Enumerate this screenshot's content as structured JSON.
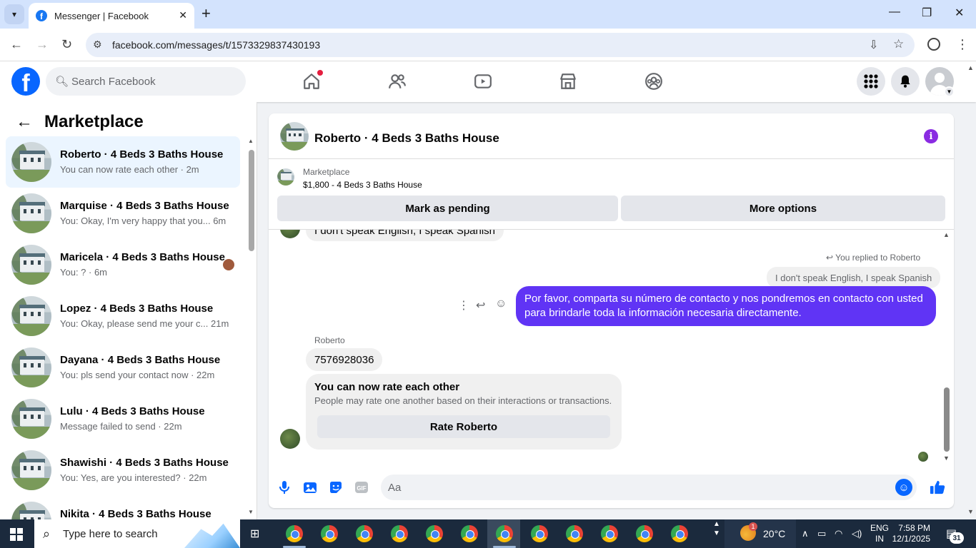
{
  "browser": {
    "tab_title": "Messenger | Facebook",
    "url": "facebook.com/messages/t/1573329837430193"
  },
  "fb": {
    "search_placeholder": "Search Facebook"
  },
  "sidebar": {
    "title": "Marketplace",
    "conversations": [
      {
        "name": "Roberto · 4 Beds 3 Baths House",
        "snippet": "You can now rate each other · 2m",
        "active": true
      },
      {
        "name": "Marquise · 4 Beds 3 Baths House",
        "snippet": "You: Okay, I'm very happy that you...  6m"
      },
      {
        "name": "Maricela · 4 Beds 3 Baths House",
        "snippet": "You: ? · 6m"
      },
      {
        "name": "Lopez · 4 Beds 3 Baths House",
        "snippet": "You: Okay, please send me your c...  21m"
      },
      {
        "name": "Dayana · 4 Beds 3 Baths House",
        "snippet": "You: pls send your contact now · 22m"
      },
      {
        "name": "Lulu · 4 Beds 3 Baths House",
        "snippet": "Message failed to send · 22m"
      },
      {
        "name": "Shawishi · 4 Beds 3 Baths House",
        "snippet": "You: Yes, are you interested? · 22m"
      },
      {
        "name": "Nikita · 4 Beds 3 Baths House",
        "snippet": ""
      }
    ]
  },
  "chat": {
    "header_name": "Roberto · 4 Beds 3 Baths House",
    "listing_category": "Marketplace",
    "listing_price": "$1,800 - 4 Beds 3 Baths House",
    "mark_pending_label": "Mark as pending",
    "more_options_label": "More options",
    "cut_message": "I don't speak English, I speak Spanish",
    "replied_tag": "You replied to Roberto",
    "reply_quote": "I don't speak English, I speak Spanish",
    "outgoing_message": "Por favor, comparta su número de contacto y nos pondremos en contacto con usted para brindarle toda la información necesaria directamente.",
    "sender_name": "Roberto",
    "incoming_message": "7576928036",
    "rate_title": "You can now rate each other",
    "rate_subtitle": "People may rate one another based on their interactions or transactions.",
    "rate_button": "Rate Roberto",
    "composer_placeholder": "Aa"
  },
  "taskbar": {
    "search_text": "Type here to search",
    "weather": "20°C",
    "weather_badge": "1",
    "lang_line1": "ENG",
    "lang_line2": "IN",
    "time": "7:58 PM",
    "date": "12/1/2025",
    "notifications": "31"
  },
  "colors": {
    "fb_blue": "#0866ff",
    "outgoing_bubble": "#6034f5",
    "active_conversation": "#ebf5ff"
  }
}
